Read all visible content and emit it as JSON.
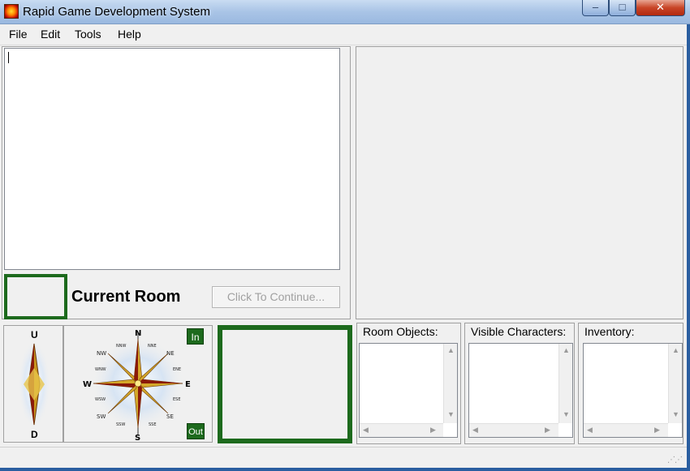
{
  "window": {
    "title": "Rapid Game Development System",
    "controls": {
      "minimize": "–",
      "maximize": "□",
      "close": "✕"
    }
  },
  "menu": [
    {
      "label": "File"
    },
    {
      "label": "Edit"
    },
    {
      "label": "Tools"
    },
    {
      "label": "Help"
    }
  ],
  "main": {
    "current_room_label": "Current Room",
    "continue_button": "Click To Continue..."
  },
  "compass": {
    "vertical": {
      "up": "U",
      "down": "D"
    },
    "directions": {
      "n": "N",
      "s": "S",
      "e": "E",
      "w": "W",
      "ne": "NE",
      "nw": "NW",
      "se": "SE",
      "sw": "SW",
      "nne": "NNE",
      "nnw": "NNW",
      "ene": "ENE",
      "ese": "ESE",
      "wnw": "WNW",
      "wsw": "WSW",
      "sse": "SSE",
      "ssw": "SSW"
    },
    "in_button": "In",
    "out_button": "Out"
  },
  "panels": {
    "room_objects": "Room Objects:",
    "visible_characters": "Visible Characters:",
    "inventory": "Inventory:"
  },
  "colors": {
    "accent_green": "#1d6a1d",
    "titlebar": "#a9c4e6",
    "close_red": "#c84527",
    "background": "#f0f0f0"
  }
}
